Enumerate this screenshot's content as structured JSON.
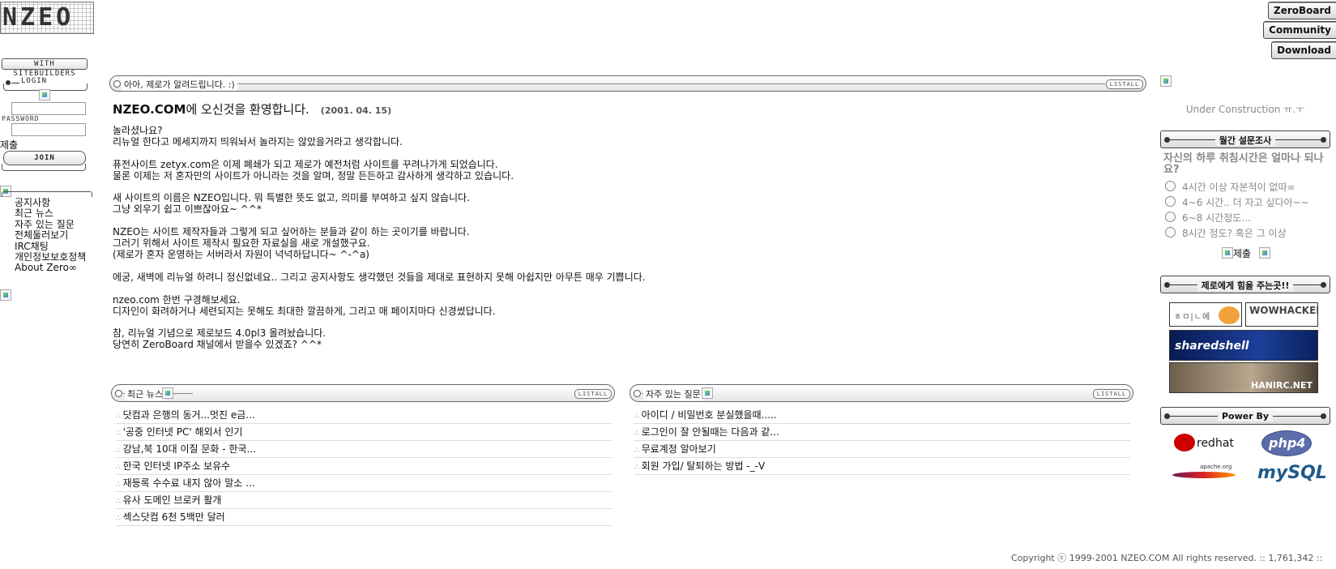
{
  "site": {
    "logo_text": "NZEO"
  },
  "top_nav": {
    "items": [
      "ZeroBoard",
      "Community",
      "Download"
    ]
  },
  "sidebar": {
    "with_sitebuilders_label": "WITH SITEBUILDERS",
    "login_label": "LOGIN",
    "password_label": "PASSWORD",
    "submit_label": "제출",
    "join_label": "JOIN",
    "nav_items": [
      "공지사항",
      "최근 뉴스",
      "자주 있는 질문",
      "전체둘러보기",
      "IRC채팅",
      "개인정보보호정책",
      "About Zero∞"
    ]
  },
  "notice_bar": {
    "title": "아아, 제로가 알려드립니다. :)",
    "listall": "LISTALL"
  },
  "welcome": {
    "title_bold": "NZEO.COM",
    "title_rest": "에 오신것을 환영합니다.",
    "date": "(2001. 04. 15)",
    "body": "놀라셨나요?\n리뉴얼 한다고 메세지까지 띄워놔서 놀라지는 않았을거라고 생각합니다.\n\n퓨전사이트 zetyx.com은 이제 폐쇄가 되고 제로가 예전처럼 사이트를 꾸려나가게 되었습니다.\n물론 이제는 저 혼자만의 사이트가 아니라는 것을 알며, 정말 든든하고 감사하게 생각하고 있습니다.\n\n새 사이트의 이름은 NZEO입니다. 뭐 특별한 뜻도 없고, 의미를 부여하고 싶지 않습니다.\n그냥 외우기 쉽고 이쁘잖아요~ ^^*\n\nNZEO는 사이트 제작자들과 그렇게 되고 싶어하는 분들과 같이 하는 곳이기를 바랍니다.\n그러기 위해서 사이트 제작시 필요한 자료실을 새로 개설했구요.\n(제로가 혼자 운영하는 서버라서 자원이 넉넉하답니다~ ^-^a)\n\n에궁, 새벽에 리뉴얼 하려니 정신없네요.. 그리고 공지사항도 생각했던 것들을 제대로 표현하지 못해 아쉽지만 아무튼 매우 기쁩니다.\n\nnzeo.com 한번 구경해보세요.\n디자인이 화려하거나 세련되지는 못해도 최대한 깔끔하게, 그리고 매 페이지마다 신경썼답니다.\n\n참, 리뉴얼 기념으로 제로보드 4.0pl3 올려놨습니다.\n당연히 ZeroBoard 채널에서 받을수 있겠죠? ^^*"
  },
  "news": {
    "title": "최근 뉴스",
    "listall": "LISTALL",
    "items": [
      "닷컴과 은행의 동거...멋진 e금...",
      "'공중 인터넷 PC' 해외서 인기",
      "강남,북 10대 이질 문화 - 한국...",
      "한국 인터넷 IP주소 보유수",
      "재등록 수수료 내지 않아 말소 ...",
      "유사 도메인 브로커 활개",
      "섹스닷컴 6천 5백만 달러"
    ]
  },
  "faq": {
    "title": "자주 있는 질문",
    "listall": "LISTALL",
    "items": [
      "아이디 / 비밀번호 분실했을때.....",
      "로그인이 잘 안될때는 다음과 같...",
      "무료계정 알아보기",
      "회원 가입/ 탈퇴하는 방법 -_-V"
    ]
  },
  "right": {
    "under_construction": "Under Construction ㅠ.ㅜ",
    "poll_title": "월간 설문조사",
    "poll_question": "자신의 하루 취침시간은 얼마나 되나요?",
    "poll_options": [
      "4시간 이상 자본적이 없따∞",
      "4~6 시간.. 더 자고 싶다아~~",
      "6~8 시간정도...",
      "8시간 정도? 혹은 그 이상"
    ],
    "poll_submit": "제출",
    "supporters_title": "제로에게 힘을 주는곳!!",
    "supporters": [
      "ㅎㅁ|ㄴ에",
      "WOWHACKER Team",
      "sharedshell",
      "HANIRC.NET"
    ],
    "powered_title": "Power By",
    "powered": [
      "redhat",
      "php4",
      "apache.org",
      "mySQL"
    ]
  },
  "footer": {
    "copyright": "Copyright ⓒ 1999-2001 NZEO.COM All rights reserved. :: 1,761,342 ::"
  },
  "colors": {
    "poll_text": "#888888",
    "redhat_red": "#cc0000",
    "php_blue": "#5b6eab",
    "mysql_blue": "#1f5a8a"
  }
}
